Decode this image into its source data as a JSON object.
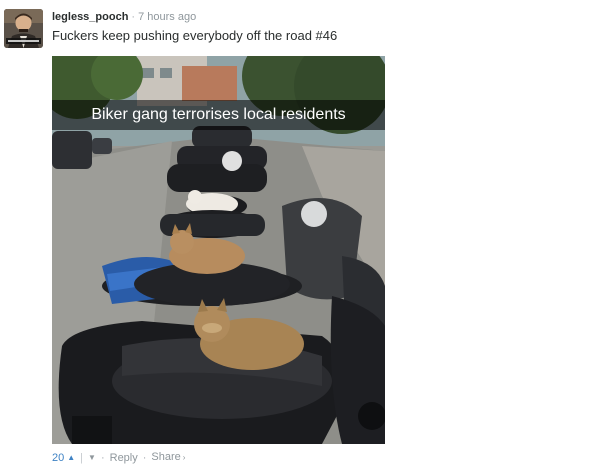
{
  "comment": {
    "username": "legless_pooch",
    "separator": "·",
    "timestamp": "7 hours ago",
    "message": "Fuckers keep pushing everybody off the road #46"
  },
  "image": {
    "caption": "Biker gang terrorises local residents"
  },
  "footer": {
    "vote_count": "20",
    "upvote_icon": "▲",
    "divider": "|",
    "downvote_icon": "▼",
    "dot": "·",
    "reply_label": "Reply",
    "share_label": "Share",
    "share_chevron": "›"
  },
  "colors": {
    "accent_blue": "#3e82c4",
    "muted_text": "#8f979c",
    "body_text": "#2a2e2e"
  }
}
